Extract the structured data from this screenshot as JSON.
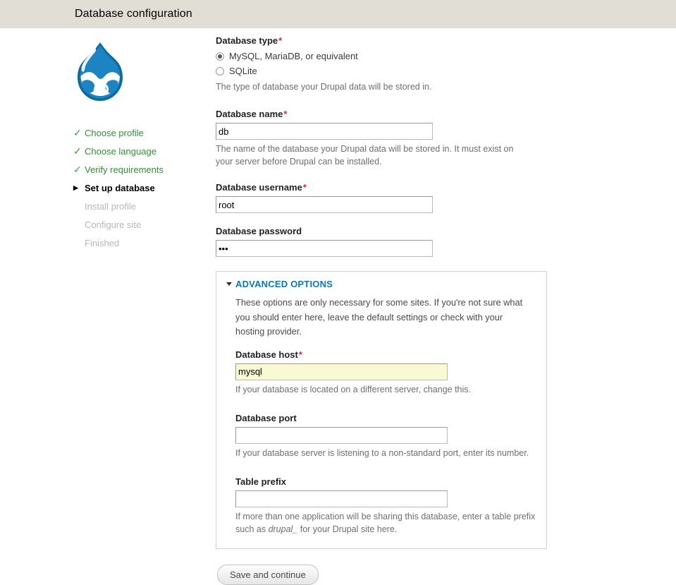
{
  "header": {
    "title": "Database configuration"
  },
  "sidebar": {
    "logo_name": "drupal-droplet-logo",
    "tasks": [
      {
        "label": "Choose profile",
        "state": "done",
        "marker": "✓"
      },
      {
        "label": "Choose language",
        "state": "done",
        "marker": "✓"
      },
      {
        "label": "Verify requirements",
        "state": "done",
        "marker": "✓"
      },
      {
        "label": "Set up database",
        "state": "active",
        "marker": "▶"
      },
      {
        "label": "Install profile",
        "state": "pending",
        "marker": ""
      },
      {
        "label": "Configure site",
        "state": "pending",
        "marker": ""
      },
      {
        "label": "Finished",
        "state": "pending",
        "marker": ""
      }
    ]
  },
  "form": {
    "database_type": {
      "label": "Database type",
      "required_marker": "*",
      "options": [
        {
          "label": "MySQL, MariaDB, or equivalent",
          "selected": true
        },
        {
          "label": "SQLite",
          "selected": false
        }
      ],
      "description": "The type of database your Drupal data will be stored in."
    },
    "database_name": {
      "label": "Database name",
      "required_marker": "*",
      "value": "db",
      "placeholder": "",
      "description": "The name of the database your Drupal data will be stored in. It must exist on your server before Drupal can be installed."
    },
    "database_username": {
      "label": "Database username",
      "required_marker": "*",
      "value": "root",
      "placeholder": ""
    },
    "database_password": {
      "label": "Database password",
      "value": "abc",
      "placeholder": ""
    },
    "advanced": {
      "legend": "ADVANCED OPTIONS",
      "intro": "These options are only necessary for some sites. If you're not sure what you should enter here, leave the default settings or check with your hosting provider.",
      "database_host": {
        "label": "Database host",
        "required_marker": "*",
        "value": "mysql",
        "placeholder": "",
        "description": "If your database is located on a different server, change this."
      },
      "database_port": {
        "label": "Database port",
        "value": "",
        "placeholder": "",
        "description": "If your database server is listening to a non-standard port, enter its number."
      },
      "table_prefix": {
        "label": "Table prefix",
        "value": "",
        "placeholder": "",
        "description_before": "If more than one application will be sharing this database, enter a table prefix such as ",
        "description_em": "drupal_",
        "description_after": " for your Drupal site here."
      }
    },
    "submit_label": "Save and continue"
  },
  "colors": {
    "header_bg": "#e0ded5",
    "accent_blue": "#0678be",
    "done_green": "#3a8b3a",
    "required_red": "#e02443",
    "highlight_yellow": "#fafad2"
  }
}
